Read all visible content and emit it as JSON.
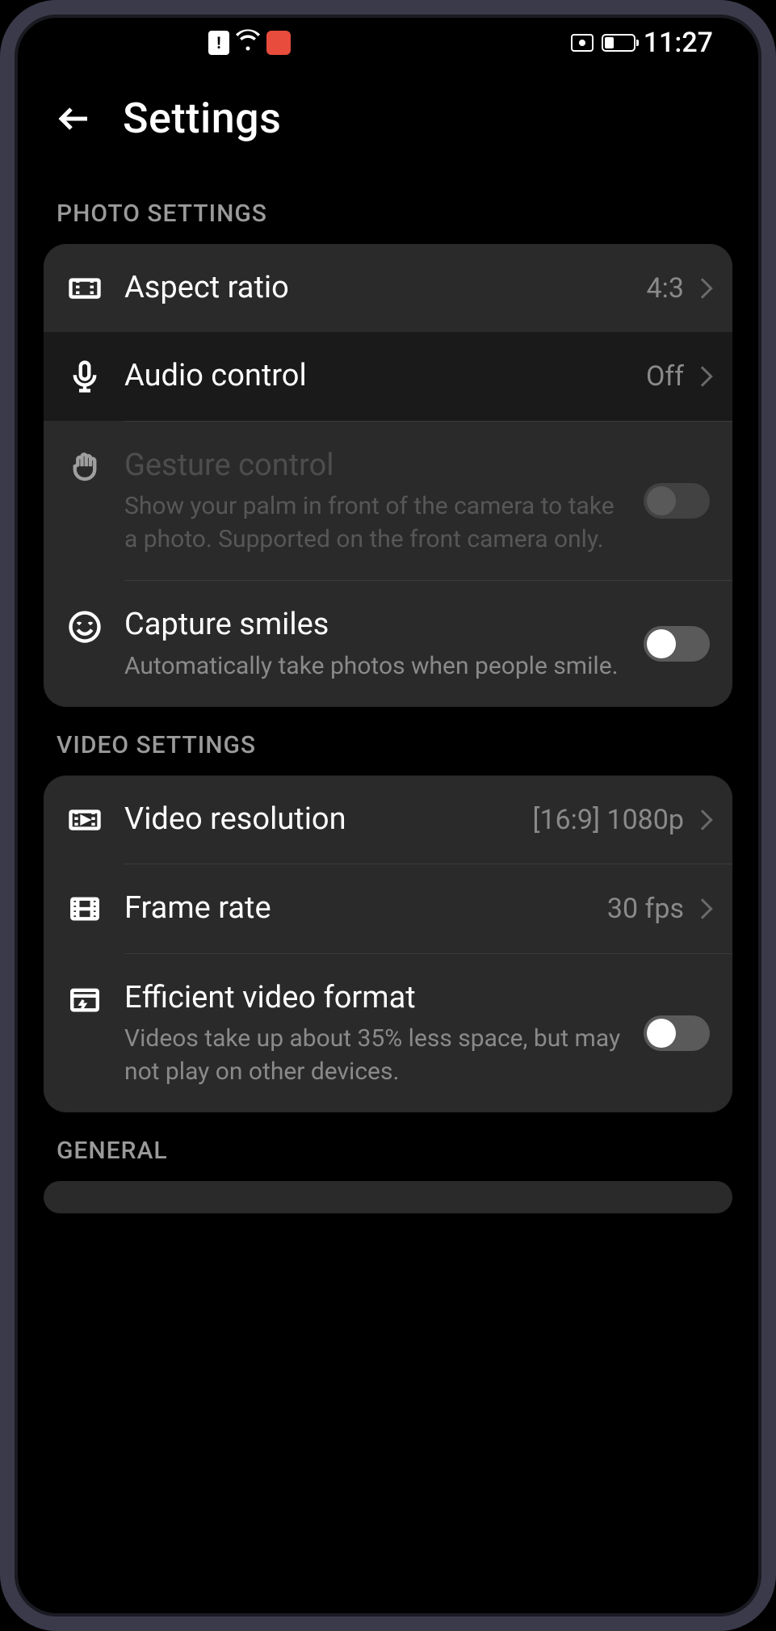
{
  "status_bar": {
    "time": "11:27"
  },
  "header": {
    "title": "Settings"
  },
  "sections": {
    "photo": {
      "header": "PHOTO SETTINGS",
      "aspect_ratio": {
        "label": "Aspect ratio",
        "value": "4:3"
      },
      "audio_control": {
        "label": "Audio control",
        "value": "Off"
      },
      "gesture_control": {
        "label": "Gesture control",
        "description": "Show your palm in front of the camera to take a photo. Supported on the front camera only."
      },
      "capture_smiles": {
        "label": "Capture smiles",
        "description": "Automatically take photos when people smile."
      }
    },
    "video": {
      "header": "VIDEO SETTINGS",
      "video_resolution": {
        "label": "Video resolution",
        "value": "[16:9] 1080p"
      },
      "frame_rate": {
        "label": "Frame rate",
        "value": "30 fps"
      },
      "efficient_format": {
        "label": "Efficient video format",
        "description": "Videos take up about 35% less space, but may not play on other devices."
      }
    },
    "general": {
      "header": "GENERAL"
    }
  }
}
